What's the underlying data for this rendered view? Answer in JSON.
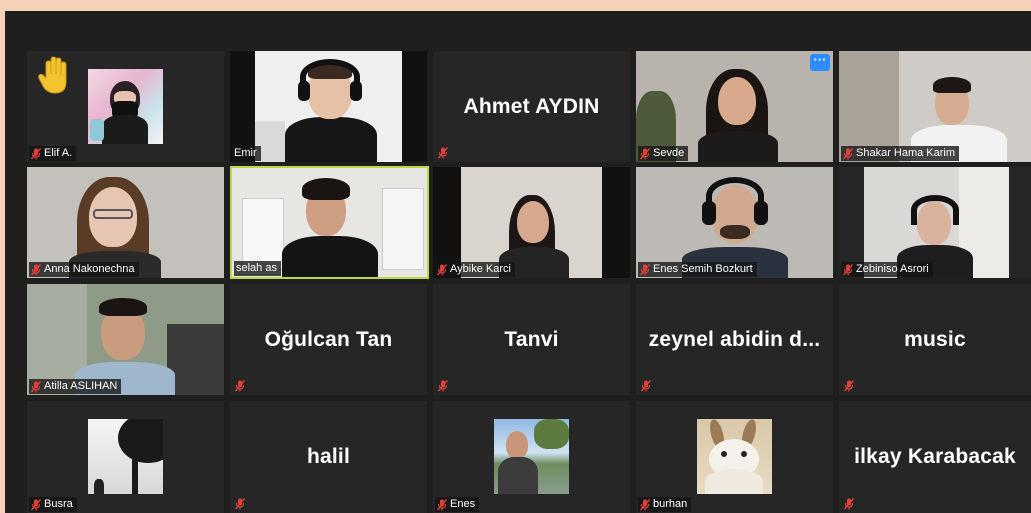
{
  "participants": [
    {
      "name": "Elif A.",
      "hand_raised": true
    },
    {
      "name": "Emir"
    },
    {
      "name": "Ahmet AYDIN"
    },
    {
      "name": "Sevde"
    },
    {
      "name": "Shakar Hama Karim"
    },
    {
      "name": "Anna Nakonechna"
    },
    {
      "name": "selah as",
      "active_speaker": true
    },
    {
      "name": "Aybike Karci"
    },
    {
      "name": "Enes Semih Bozkurt"
    },
    {
      "name": "Zebiniso Asrori"
    },
    {
      "name": "Atilla ASLIHAN"
    },
    {
      "name": "Oğulcan Tan"
    },
    {
      "name": "Tanvi"
    },
    {
      "name": "zeynel abidin d..."
    },
    {
      "name": "music"
    },
    {
      "name": "Busra"
    },
    {
      "name": "halil"
    },
    {
      "name": "Enes"
    },
    {
      "name": "burhan"
    },
    {
      "name": "ilkay Karabacak"
    }
  ],
  "more_button": "···",
  "colors": {
    "frame_background": "#f6d2b8",
    "gallery_background": "#1f1f1f",
    "tile_background": "#262626",
    "active_speaker_border": "#b8d94a",
    "mute_icon": "#e0403a",
    "menu_button": "#2d8cff"
  },
  "icons": {
    "muted": "muted-microphone-icon",
    "raised_hand": "raised-hand-icon",
    "more": "more-options-icon"
  }
}
